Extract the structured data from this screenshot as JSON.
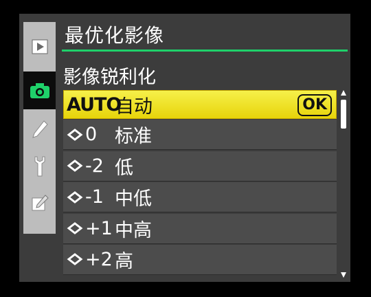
{
  "header": {
    "title": "最优化影像"
  },
  "sub": {
    "title": "影像锐利化"
  },
  "sidebar": {
    "tabs": [
      {
        "icon": "playback-icon"
      },
      {
        "icon": "camera-icon"
      },
      {
        "icon": "pencil-icon"
      },
      {
        "icon": "wrench-icon"
      },
      {
        "icon": "retouch-icon"
      }
    ]
  },
  "options": [
    {
      "code": "AUTO",
      "label": "自动",
      "ok": "OK"
    },
    {
      "code": "0",
      "label": "标准"
    },
    {
      "code": "-2",
      "label": "低"
    },
    {
      "code": "-1",
      "label": "中低"
    },
    {
      "code": "+1",
      "label": "中高"
    },
    {
      "code": "+2",
      "label": "高"
    }
  ],
  "colors": {
    "accent_green": "#1fd16a",
    "highlight": "#f0e12a",
    "background": "#3c3c3c"
  }
}
